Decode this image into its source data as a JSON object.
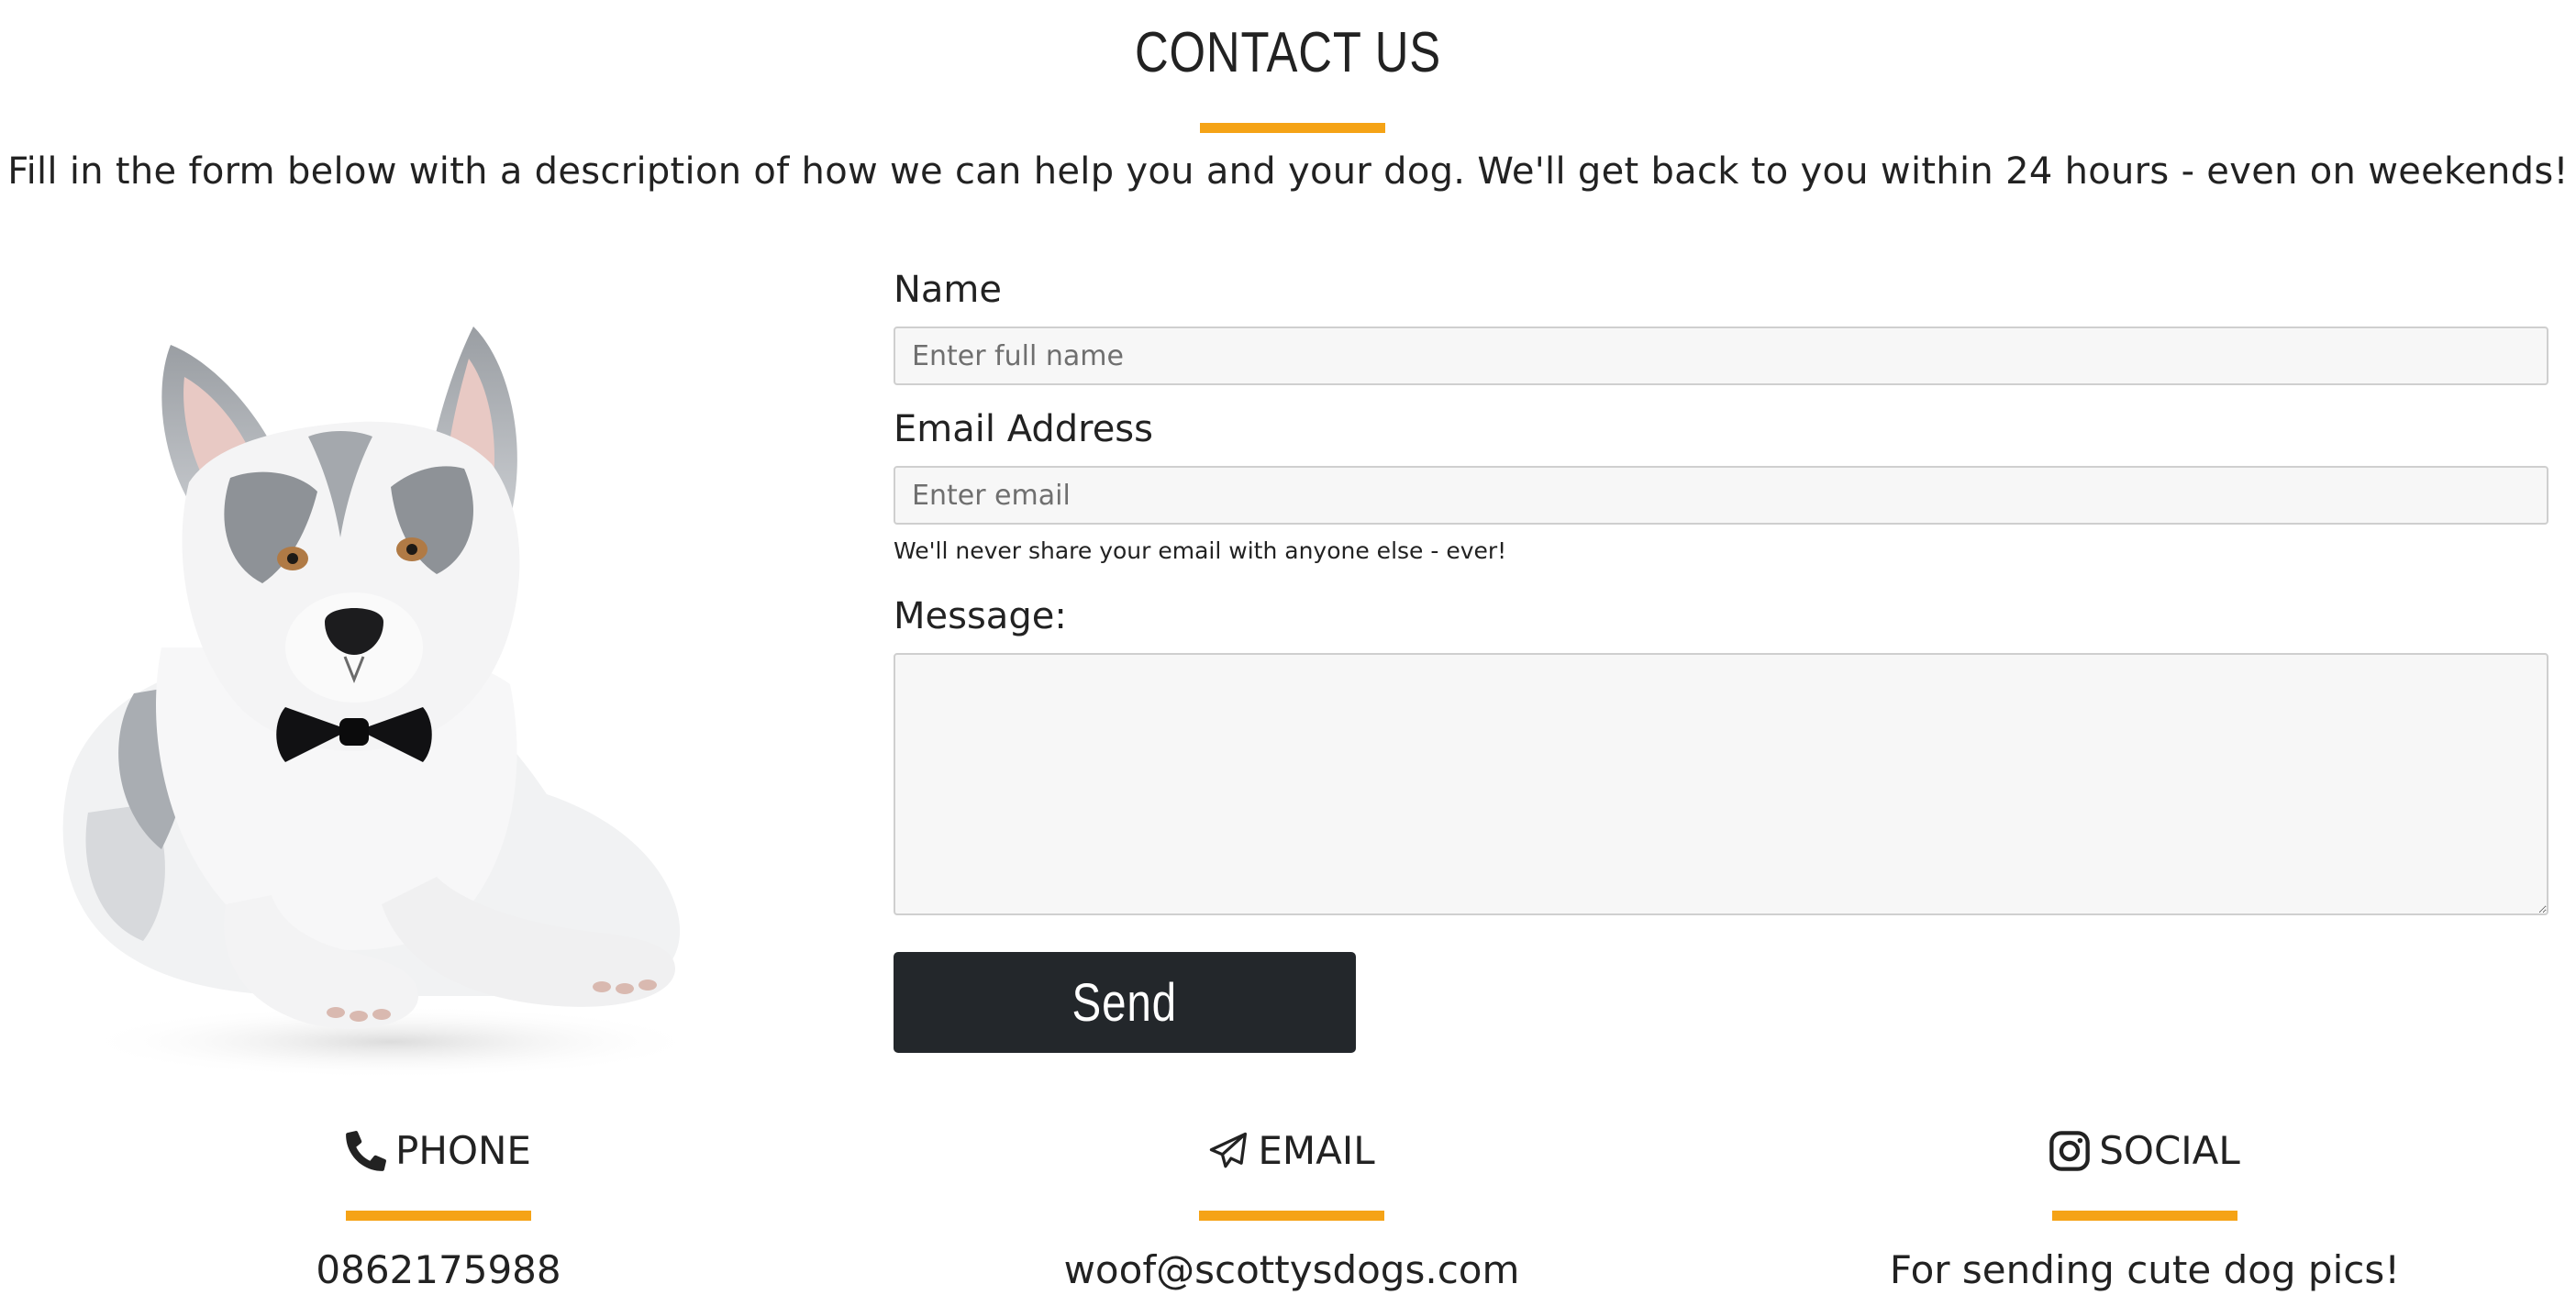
{
  "contact": {
    "title": "CONTACT US",
    "intro": "Fill in the form below with a description of how we can help you and your dog. We'll get back to you within 24 hours - even on weekends!"
  },
  "image": {
    "icon": "husky-dog-with-bow-tie"
  },
  "form": {
    "name_label": "Name",
    "name_placeholder": "Enter full name",
    "name_value": "",
    "email_label": "Email Address",
    "email_placeholder": "Enter email",
    "email_value": "",
    "email_help": "We'll never share your email with anyone else - ever!",
    "message_label": "Message:",
    "message_value": "",
    "send_label": "Send"
  },
  "details": [
    {
      "icon": "phone-icon",
      "heading": "PHONE",
      "value": "0862175988"
    },
    {
      "icon": "paper-plane-icon",
      "heading": "EMAIL",
      "value": "woof@scottysdogs.com"
    },
    {
      "icon": "instagram-icon",
      "heading": "SOCIAL",
      "value": "For sending cute dog pics!"
    }
  ],
  "colors": {
    "accent": "#f5a316",
    "button": "#23272b",
    "text": "#222222",
    "input_bg": "#f7f7f7",
    "input_border": "#cfcfcf"
  }
}
